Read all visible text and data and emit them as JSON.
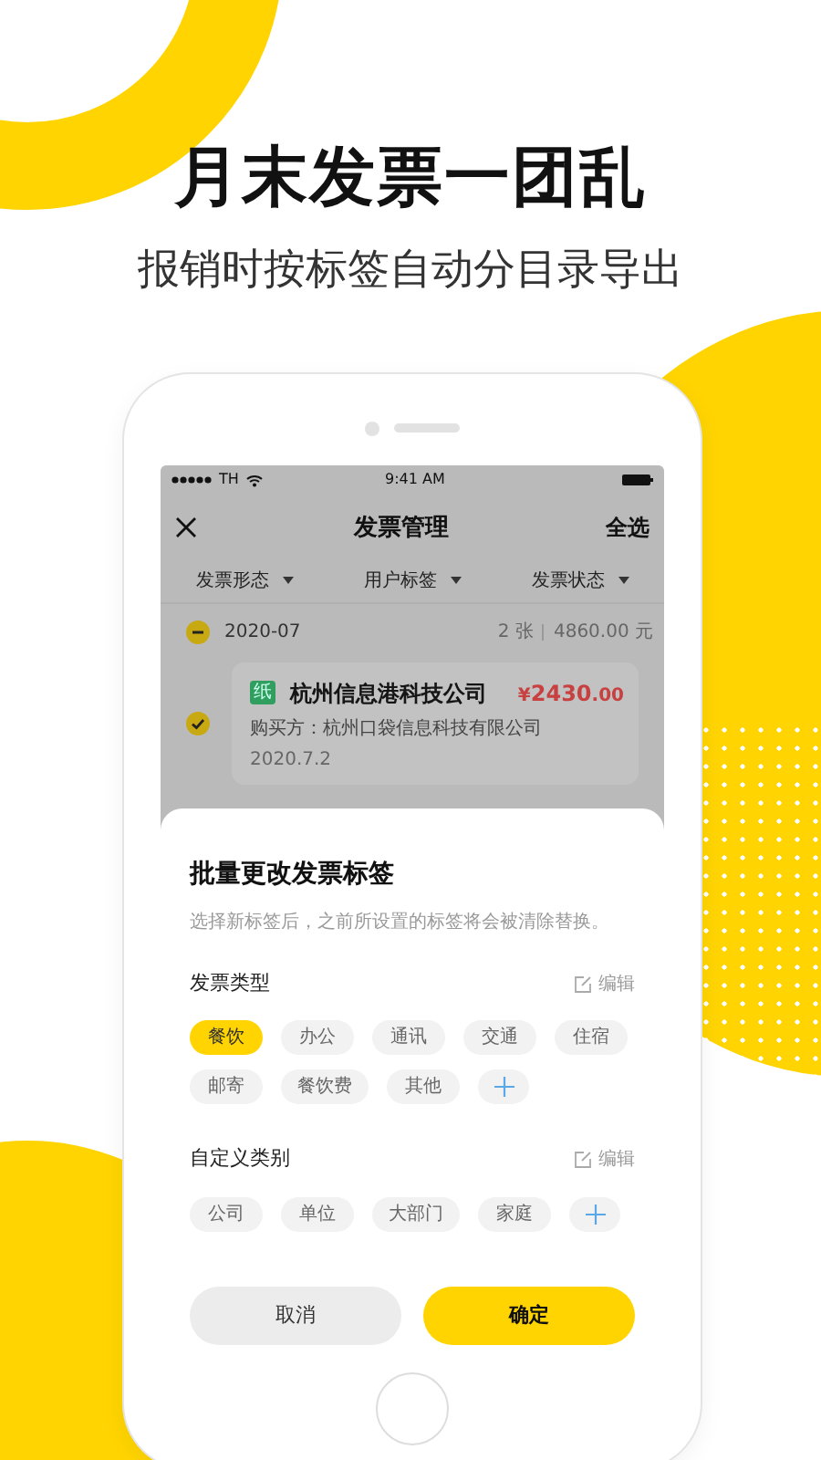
{
  "headline": "月末发票一团乱",
  "subheadline": "报销时按标签自动分目录导出",
  "status_bar": {
    "carrier": "TH",
    "time": "9:41 AM"
  },
  "nav": {
    "title": "发票管理",
    "action": "全选"
  },
  "filters": [
    {
      "label": "发票形态"
    },
    {
      "label": "用户标签"
    },
    {
      "label": "发票状态"
    }
  ],
  "group": {
    "date": "2020-07",
    "count": "2 张",
    "total": "4860.00 元"
  },
  "invoice": {
    "tag": "纸",
    "company": "杭州信息港科技公司",
    "currency": "¥",
    "amount": "2430",
    "decimals": ".00",
    "buyer": "购买方：杭州口袋信息科技有限公司",
    "date": "2020.7.2",
    "selected": true
  },
  "sheet": {
    "title": "批量更改发票标签",
    "note": "选择新标签后，之前所设置的标签将会被清除替换。",
    "sections": [
      {
        "title": "发票类型",
        "edit": "编辑",
        "tags": [
          {
            "label": "餐饮",
            "selected": true
          },
          {
            "label": "办公",
            "selected": false
          },
          {
            "label": "通讯",
            "selected": false
          },
          {
            "label": "交通",
            "selected": false
          },
          {
            "label": "住宿",
            "selected": false
          },
          {
            "label": "邮寄",
            "selected": false
          },
          {
            "label": "餐饮费",
            "selected": false
          },
          {
            "label": "其他",
            "selected": false
          }
        ]
      },
      {
        "title": "自定义类别",
        "edit": "编辑",
        "tags": [
          {
            "label": "公司",
            "selected": false
          },
          {
            "label": "单位",
            "selected": false
          },
          {
            "label": "大部门",
            "selected": false
          },
          {
            "label": "家庭",
            "selected": false
          }
        ]
      }
    ],
    "cancel": "取消",
    "confirm": "确定"
  }
}
